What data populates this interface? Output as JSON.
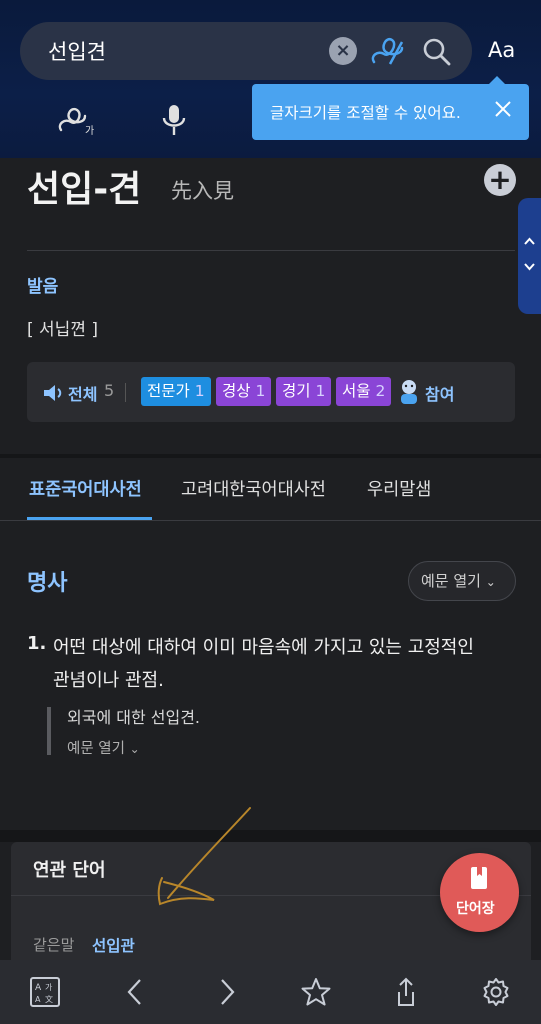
{
  "search": {
    "query": "선입견"
  },
  "header": {
    "font_size_label": "Aa"
  },
  "tooltip": {
    "text": "글자크기를 조절할 수 있어요."
  },
  "entry": {
    "headword": "선입-견",
    "hanja": "先入見",
    "pronunciation_label": "발음",
    "pronunciation": "[ 서닙껸 ]"
  },
  "audio": {
    "all_label": "전체",
    "all_count": "5",
    "tags": [
      {
        "label": "전문가",
        "count": "1"
      },
      {
        "label": "경상",
        "count": "1"
      },
      {
        "label": "경기",
        "count": "1"
      },
      {
        "label": "서울",
        "count": "2"
      }
    ],
    "participate_label": "참여"
  },
  "tabs": [
    "표준국어대사전",
    "고려대한국어대사전",
    "우리말샘"
  ],
  "definition": {
    "pos": "명사",
    "example_toggle": "예문 열기",
    "num": "1.",
    "text_line1": "어떤 대상에 대하여 이미 마음속에 가지고 있는 고정적인",
    "text_line2": "관념이나 관점.",
    "example": "외국에 대한 선입견.",
    "example_open": "예문 열기"
  },
  "related": {
    "title": "연관 단어",
    "synonym_label": "같은말",
    "synonym_value": "선입관"
  },
  "fab": {
    "label": "단어장"
  },
  "colors": {
    "accent": "#8ec4ff",
    "tooltip": "#4aa3f0",
    "fab": "#e05a58",
    "header": "#0c1f48"
  }
}
